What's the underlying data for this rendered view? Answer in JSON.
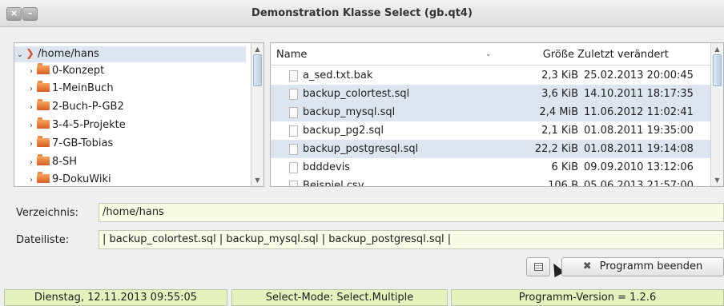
{
  "window": {
    "title": "Demonstration Klasse Select (gb.qt4)",
    "close_glyph": "×",
    "minimize_glyph": "–"
  },
  "tree": {
    "root": "/home/hans",
    "items": [
      "0-Konzept",
      "1-MeinBuch",
      "2-Buch-P-GB2",
      "3-4-5-Projekte",
      "7-GB-Tobias",
      "8-SH",
      "9-DokuWiki"
    ]
  },
  "files": {
    "columns": {
      "name": "Name",
      "size": "Größe",
      "date": "Zuletzt verändert"
    },
    "rows": [
      {
        "name": "a_sed.txt.bak",
        "size": "2,3 KiB",
        "date": "25.02.2013 20:00:45",
        "selected": false
      },
      {
        "name": "backup_colortest.sql",
        "size": "3,6 KiB",
        "date": "14.10.2011 18:17:35",
        "selected": true
      },
      {
        "name": "backup_mysql.sql",
        "size": "2,4 MiB",
        "date": "11.06.2012 11:02:41",
        "selected": true
      },
      {
        "name": "backup_pg2.sql",
        "size": "2,1 KiB",
        "date": "01.08.2011 19:35:00",
        "selected": false
      },
      {
        "name": "backup_postgresql.sql",
        "size": "22,2 KiB",
        "date": "01.08.2011 19:14:08",
        "selected": true
      },
      {
        "name": "bdddevis",
        "size": "6 KiB",
        "date": "09.09.2010 13:12:06",
        "selected": false
      },
      {
        "name": "Beispiel.csv",
        "size": "106 B",
        "date": "05.06.2013 21:57:00",
        "selected": false
      }
    ]
  },
  "form": {
    "directory_label": "Verzeichnis:",
    "directory_value": "/home/hans",
    "filelist_label": "Dateiliste:",
    "filelist_value": "| backup_colortest.sql | backup_mysql.sql | backup_postgresql.sql |"
  },
  "buttons": {
    "quit_label": "Programm beenden",
    "quit_glyph": "✖"
  },
  "statusbar": {
    "datetime": "Dienstag, 12.11.2013 09:55:05",
    "mode": "Select-Mode:  Select.Multiple",
    "version": "Programm-Version = 1.2.6"
  },
  "icons": {
    "window_close": "close-icon",
    "window_minimize": "minimize-icon",
    "tree_expand": "chevron-right-icon",
    "tree_collapse": "chevron-down-icon",
    "folder": "folder-icon",
    "file": "file-icon",
    "grid_button": "list-view-icon",
    "quit": "close-icon"
  },
  "colors": {
    "selection": "#dde6f0",
    "field_bg": "#fafbe5",
    "status_bg": "#e4f3bd"
  }
}
